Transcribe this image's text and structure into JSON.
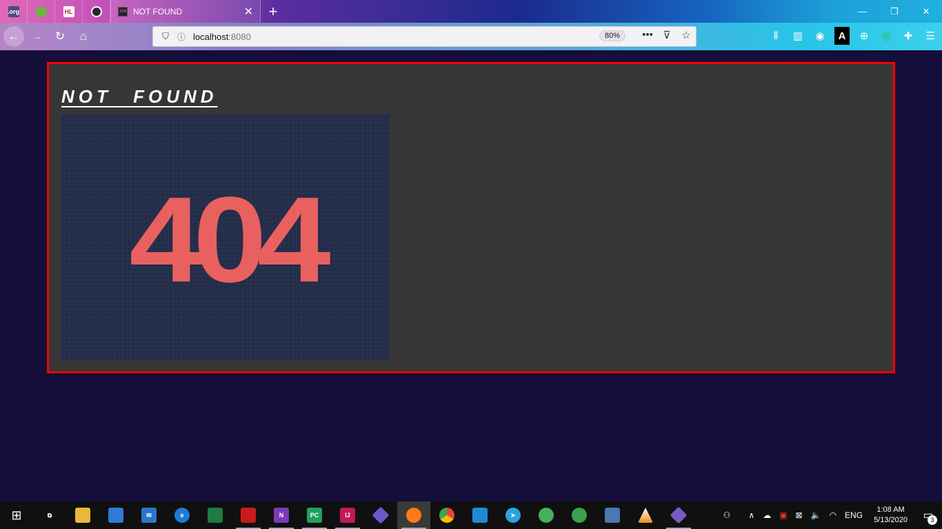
{
  "browser": {
    "pinned_tabs": [
      {
        "icon": "spring-boot-org-icon",
        "label": ".org",
        "color": "#4b4b7a"
      },
      {
        "icon": "spring-leaf-icon",
        "label": "",
        "color": "#6db33f"
      },
      {
        "icon": "hl-icon",
        "label": "HL",
        "color": "#c6283a"
      },
      {
        "icon": "github-icon",
        "label": "",
        "color": "#24292e"
      }
    ],
    "active_tab": {
      "title": "NOT FOUND",
      "favicon": "404-favicon",
      "close_glyph": "✕"
    },
    "new_tab_glyph": "+",
    "window_controls": {
      "minimize": "—",
      "restore": "❐",
      "close": "✕"
    },
    "nav": {
      "back": "←",
      "forward": "→",
      "reload": "↻",
      "home": "⌂"
    },
    "address": {
      "host": "localhost",
      "port": ":8080",
      "zoom": "80%",
      "shield": "⛉",
      "info": "ⓘ"
    },
    "address_actions": {
      "more": "•••",
      "pocket": "⊽",
      "bookmark": "☆"
    },
    "toolbar_icons": [
      {
        "name": "library-icon",
        "glyph": "⫴"
      },
      {
        "name": "sidebar-icon",
        "glyph": "▥"
      },
      {
        "name": "account-icon",
        "glyph": "◉"
      },
      {
        "name": "font-ext-icon",
        "glyph": "A"
      },
      {
        "name": "vpn-ext-icon",
        "glyph": "⊕"
      },
      {
        "name": "green-ext-icon",
        "glyph": "◎"
      },
      {
        "name": "extensions-icon",
        "glyph": "✚"
      },
      {
        "name": "menu-icon",
        "glyph": "☰"
      }
    ]
  },
  "page": {
    "heading": "NOT  FOUND",
    "image_text": "404",
    "accent_color": "#e8615f",
    "border_color": "#ff0000"
  },
  "taskbar": {
    "start_glyph": "⊞",
    "apps": [
      {
        "name": "task-view-icon",
        "label": "",
        "color": "#101010",
        "glyph": "⧉"
      },
      {
        "name": "file-explorer-icon",
        "label": "",
        "color": "#e8b83a",
        "glyph": "▬"
      },
      {
        "name": "store-icon",
        "label": "",
        "color": "#2f7bd6",
        "glyph": "⊞"
      },
      {
        "name": "mail-icon",
        "label": "",
        "color": "#2a78c8",
        "glyph": "✉"
      },
      {
        "name": "edge-icon",
        "label": "",
        "color": "#1f7bd4",
        "glyph": "e"
      },
      {
        "name": "xbox-icon",
        "label": "",
        "color": "#1e7b44",
        "glyph": "✖"
      },
      {
        "name": "acrobat-icon",
        "label": "",
        "color": "#c91b1b",
        "glyph": "⅄"
      },
      {
        "name": "onenote-icon",
        "label": "N",
        "color": "#7b3ab7",
        "glyph": ""
      },
      {
        "name": "pycharm-icon",
        "label": "PC",
        "color": "#22a05a",
        "glyph": ""
      },
      {
        "name": "intellij-icon",
        "label": "IJ",
        "color": "#c2185b",
        "glyph": ""
      },
      {
        "name": "git-icon",
        "label": "",
        "color": "#6a5acd",
        "glyph": "◆"
      },
      {
        "name": "firefox-icon",
        "label": "",
        "color": "#ff7a18",
        "glyph": "●"
      },
      {
        "name": "chrome-icon",
        "label": "",
        "color": "#34a853",
        "glyph": "◉"
      },
      {
        "name": "vscode-icon",
        "label": "",
        "color": "#1e8ad6",
        "glyph": "⟨⟩"
      },
      {
        "name": "telegram-icon",
        "label": "",
        "color": "#2aa3df",
        "glyph": "➤"
      },
      {
        "name": "send-icon",
        "label": "",
        "color": "#45b05a",
        "glyph": "➶"
      },
      {
        "name": "ie-download-icon",
        "label": "",
        "color": "#3aa24f",
        "glyph": "⬇"
      },
      {
        "name": "postgres-icon",
        "label": "",
        "color": "#4a78b5",
        "glyph": "⎈"
      },
      {
        "name": "vlc-icon",
        "label": "",
        "color": "#f28a1a",
        "glyph": "▲"
      },
      {
        "name": "git-extensions-icon",
        "label": "",
        "color": "#7a5ac8",
        "glyph": "◆"
      }
    ],
    "tray": {
      "people": "⚇",
      "chevron": "∧",
      "onedrive": "☁",
      "antivirus": "▣",
      "network_x": "⊠",
      "volume": "🔈",
      "wifi": "◠",
      "language": "ENG",
      "time": "1:08 AM",
      "date": "5/13/2020",
      "notification_icon": "▭",
      "notification_count": "3"
    }
  }
}
